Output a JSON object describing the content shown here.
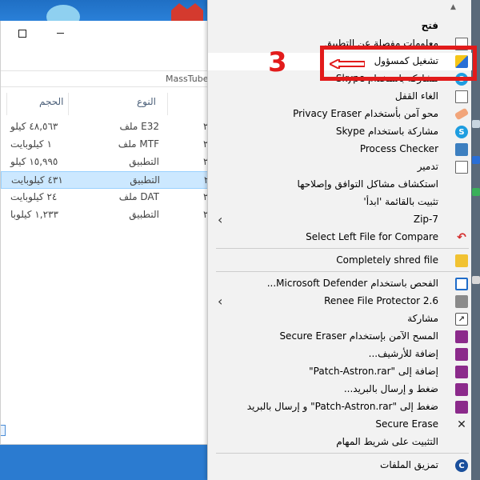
{
  "desktop": {
    "accent_colors": {
      "annotation": "#e21b1b",
      "selection": "#cce8ff",
      "menu_bg": "#f2f2f2"
    }
  },
  "explorer": {
    "address_text": "MassTube",
    "columns": {
      "size": "الحجم",
      "type": "النوع"
    },
    "files": [
      {
        "size": "٤٨,٥٦٣ كيلو",
        "type": "ملف E32",
        "date": "٢",
        "selected": false
      },
      {
        "size": "١ كيلوبايت",
        "type": "ملف MTF",
        "date": "٢",
        "selected": false
      },
      {
        "size": "١٥,٩٩٥ كيلو",
        "type": "التطبيق",
        "date": "٢",
        "selected": false
      },
      {
        "size": "٤٣١ كيلوبايت",
        "type": "التطبيق",
        "date": "٢٠",
        "selected": true
      },
      {
        "size": "٢٤ كيلوبايت",
        "type": "ملف DAT",
        "date": "٢",
        "selected": false
      },
      {
        "size": "١,٢٣٣ كيلوبا",
        "type": "التطبيق",
        "date": "٢",
        "selected": false
      }
    ]
  },
  "context_menu": {
    "items": [
      {
        "label": "فتح",
        "icon": "none",
        "bold": true
      },
      {
        "label": "معلومات مفصلة عن التطبيق",
        "icon": "document-icon"
      },
      {
        "label": "تشغيل كمسؤول",
        "icon": "uac-shield-icon",
        "highlighted": true
      },
      {
        "label": "مشاركة باستخدام Skype",
        "icon": "skype-icon"
      },
      {
        "label": "الغاء القفل",
        "icon": "document-icon"
      },
      {
        "label": "محو آمن بأستخدام Privacy Eraser",
        "icon": "eraser-icon"
      },
      {
        "label": "مشاركة باستخدام Skype",
        "icon": "skype-icon"
      },
      {
        "label": "Process Checker",
        "icon": "monitor-icon"
      },
      {
        "label": "تدمير",
        "icon": "document-icon"
      },
      {
        "label": "استكشاف مشاكل التوافق وإصلاحها",
        "icon": "none"
      },
      {
        "label": "تثبيت بالقائمة 'ابدأ'",
        "icon": "none"
      },
      {
        "label": "7-Zip",
        "icon": "none",
        "submenu": true
      },
      {
        "label": "Select Left File for Compare",
        "icon": "undo-icon"
      },
      {
        "label": "Completely shred file",
        "icon": "shred-icon"
      },
      {
        "label": "الفحص باستخدام Microsoft Defender...",
        "icon": "defender-icon"
      },
      {
        "label": "Renee File Protector 2.6",
        "icon": "lock-icon",
        "submenu": true
      },
      {
        "label": "مشاركة",
        "icon": "share-icon"
      },
      {
        "label": "المسح الآمن بإستخدام Secure Eraser",
        "icon": "rar-icon"
      },
      {
        "label": "إضافة للأرشيف...",
        "icon": "rar-icon"
      },
      {
        "label": "إضافة إلى \"Patch-Astron.rar\"",
        "icon": "rar-icon"
      },
      {
        "label": "ضغط و إرسال بالبريد...",
        "icon": "rar-icon"
      },
      {
        "label": "ضغط إلى \"Patch-Astron.rar\" و إرسال بالبريد",
        "icon": "rar-icon"
      },
      {
        "label": "Secure Erase",
        "icon": "x-icon"
      },
      {
        "label": "التثبيت على شريط المهام",
        "icon": "none"
      },
      {
        "label": "تمزيق الملفات",
        "icon": "shredder-ring-icon"
      }
    ]
  },
  "annotation": {
    "step_number": "3"
  }
}
